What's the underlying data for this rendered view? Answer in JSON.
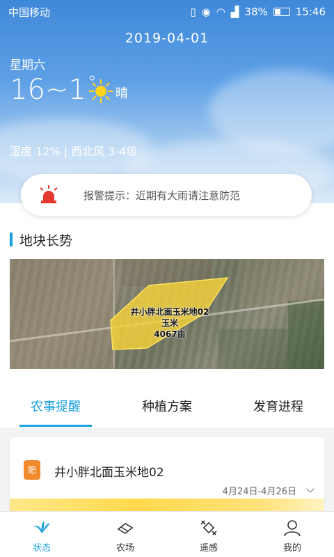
{
  "status_bar": {
    "carrier": "中国移动",
    "battery": "38%",
    "time": "15:46"
  },
  "weather": {
    "date": "2019-04-01",
    "weekday": "星期六",
    "temperature": "16~1",
    "degree_symbol": "°",
    "condition": "晴",
    "humidity_wind": "湿度 12% | 西北风 3-4级"
  },
  "alert": {
    "text": "报警提示：近期有大雨请注意防范"
  },
  "section": {
    "title": "地块长势"
  },
  "plot": {
    "name": "井小胖北面玉米地02",
    "crop": "玉米",
    "area": "4067亩"
  },
  "tabs": [
    {
      "label": "农事提醒",
      "active": true
    },
    {
      "label": "种植方案",
      "active": false
    },
    {
      "label": "发育进程",
      "active": false
    }
  ],
  "reminder": {
    "icon_text": "肥",
    "title": "井小胖北面玉米地02",
    "date_range": "4月24日-4月26日"
  },
  "bottom_nav": [
    {
      "label": "状态",
      "icon": "status-icon",
      "active": true
    },
    {
      "label": "农场",
      "icon": "farm-icon",
      "active": false
    },
    {
      "label": "遥感",
      "icon": "remote-sensing-icon",
      "active": false
    },
    {
      "label": "我的",
      "icon": "profile-icon",
      "active": false
    }
  ],
  "colors": {
    "accent": "#1aa0e0",
    "alert_red": "#e23a2e",
    "plot_yellow": "#f5d23a",
    "fertilizer_orange": "#f08a2c"
  }
}
